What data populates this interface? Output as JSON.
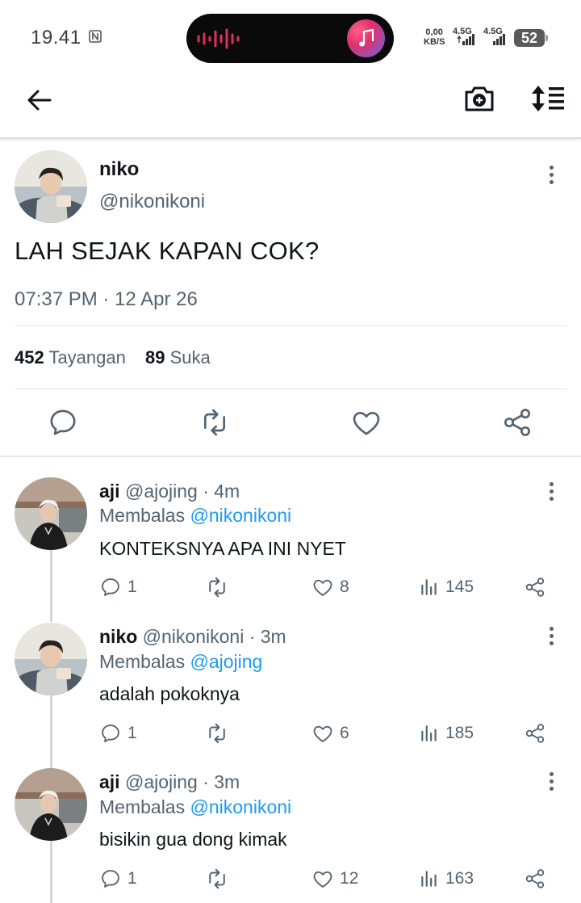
{
  "status_bar": {
    "time": "19.41",
    "net_speed_value": "0,00",
    "net_speed_unit": "KB/S",
    "signal1": "4.5G",
    "signal2": "4.5G",
    "battery": "52"
  },
  "header": {
    "back_icon": "arrow-left-icon",
    "camera_icon": "camera-plus-icon",
    "sort_icon": "sort-list-icon"
  },
  "tweet": {
    "name": "niko",
    "handle": "@nikonikoni",
    "text": "LAH SEJAK KAPAN COK?",
    "meta": "07:37 PM · 12 Apr 26",
    "views_count": "452",
    "views_label": "Tayangan",
    "likes_count": "89",
    "likes_label": "Suka"
  },
  "replies": [
    {
      "name": "aji",
      "handle_time": "@ajojing · 4m",
      "replying_label": "Membalas",
      "replying_to": "@nikonikoni",
      "text": "KONTEKSNYA APA INI NYET",
      "reply_count": "1",
      "like_count": "8",
      "view_count": "145"
    },
    {
      "name": "niko",
      "handle_time": "@nikonikoni · 3m",
      "replying_label": "Membalas",
      "replying_to": "@ajojing",
      "text": "adalah pokoknya",
      "reply_count": "1",
      "like_count": "6",
      "view_count": "185"
    },
    {
      "name": "aji",
      "handle_time": "@ajojing · 3m",
      "replying_label": "Membalas",
      "replying_to": "@nikonikoni",
      "text": "bisikin gua dong kimak",
      "reply_count": "1",
      "like_count": "12",
      "view_count": "163"
    }
  ],
  "colors": {
    "link": "#1d9bf0",
    "secondary_text": "#536471",
    "primary_text": "#0f1419"
  }
}
